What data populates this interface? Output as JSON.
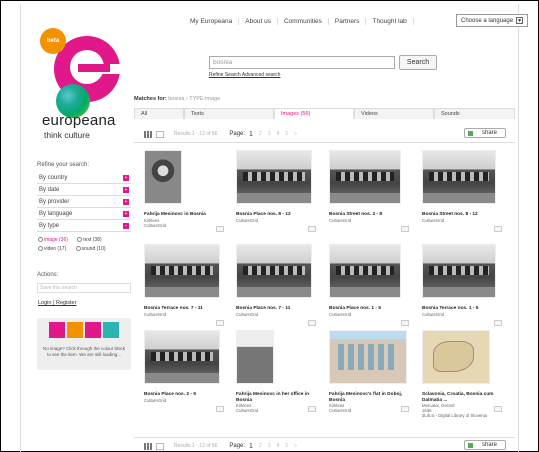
{
  "nav": {
    "items": [
      "My Europeana",
      "About us",
      "Communities",
      "Partners",
      "Thought lab"
    ],
    "language_label": "Choose a language"
  },
  "logo": {
    "beta": "beta",
    "brand": "europeana",
    "tagline": "think culture"
  },
  "search": {
    "value": "bosnia",
    "button": "Search",
    "refine_link": "Refine Search",
    "advanced_link": "Advanced search"
  },
  "matches": {
    "label": "Matches for:",
    "query": "bosnia",
    "filter": "TYPE:image"
  },
  "sidebar": {
    "refine_title": "Refine your search:",
    "facets": [
      "By country",
      "By date",
      "By provider",
      "By language",
      "By type"
    ],
    "types": [
      {
        "label": "image (36)",
        "selected": true
      },
      {
        "label": "text (38)",
        "selected": false
      },
      {
        "label": "video (17)",
        "selected": false
      },
      {
        "label": "sound (10)",
        "selected": false
      }
    ],
    "actions_title": "Actions:",
    "actions_placeholder": "Save this search",
    "login": "Login",
    "register": "Register",
    "colour_text": "No image? Click through the colour block to see the item. We are still loading...",
    "colour_blocks": [
      "#e0188a",
      "#f29200",
      "#e0188a",
      "#2ab5b0"
    ]
  },
  "tabs": [
    {
      "label": "All",
      "active": false
    },
    {
      "label": "Texts",
      "active": false
    },
    {
      "label": "Images (56)",
      "active": true
    },
    {
      "label": "Videos",
      "active": false
    },
    {
      "label": "Sounds",
      "active": false
    }
  ],
  "pager": {
    "results": "Results 1 - 12 of 56",
    "page_label": "Page:",
    "current": "1",
    "pages": [
      "2",
      "3",
      "4",
      "5"
    ],
    "next": "»",
    "share": "share"
  },
  "results": [
    {
      "title": "Fahrija Mesinovc in Bosnia",
      "meta": [
        "Kirklees",
        "CultureGrid"
      ],
      "thumb": "portrait"
    },
    {
      "title": "Bosnia Place nos. 8 - 12",
      "meta": [
        "CultureGrid"
      ],
      "thumb": "house"
    },
    {
      "title": "Bosnia Street nos. 2 - 8",
      "meta": [
        "CultureGrid"
      ],
      "thumb": "house"
    },
    {
      "title": "Bosnia Street nos. 8 - 12",
      "meta": [
        "CultureGrid"
      ],
      "thumb": "house"
    },
    {
      "title": "Bosnia Terrace nos. 7 - 11",
      "meta": [
        "CultureGrid"
      ],
      "thumb": "house"
    },
    {
      "title": "Bosnia Place nos. 7 - 11",
      "meta": [
        "CultureGrid"
      ],
      "thumb": "house"
    },
    {
      "title": "Bosnia Place nos. 1 - 5",
      "meta": [
        "CultureGrid"
      ],
      "thumb": "house"
    },
    {
      "title": "Bosnia Terrace nos. 1 - 5",
      "meta": [
        "CultureGrid"
      ],
      "thumb": "house"
    },
    {
      "title": "Bosnia Place nos. 2 - 6",
      "meta": [
        "CultureGrid"
      ],
      "thumb": "house"
    },
    {
      "title": "Fahrija Mesinovc in her office in Bosnia",
      "meta": [
        "Kirklees",
        "CultureGrid"
      ],
      "thumb": "portrait2"
    },
    {
      "title": "Fahrija Mesinovc's flat in Doboj, Bosnia",
      "meta": [
        "Kirklees",
        "CultureGrid"
      ],
      "thumb": "flat"
    },
    {
      "title": "Sclavonia, Croatia, Bosnia cum Dalmatia ...",
      "meta": [
        "Mercator, Gerard",
        "1636",
        "dLib.si - Digital Library of Slovenia"
      ],
      "thumb": "map"
    }
  ]
}
